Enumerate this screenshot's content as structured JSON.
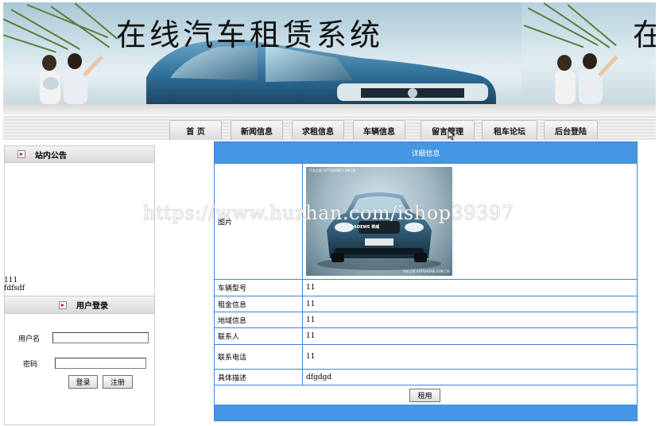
{
  "header": {
    "title": "在线汽车租赁系统",
    "title_repeat": "在"
  },
  "nav": {
    "items": [
      {
        "label": "首  页"
      },
      {
        "label": "新闻信息"
      },
      {
        "label": "求租信息"
      },
      {
        "label": "车辆信息"
      },
      {
        "label": "留言管理"
      },
      {
        "label": "租车论坛"
      },
      {
        "label": "后台登陆"
      }
    ]
  },
  "sidebar": {
    "notice_title": "站内公告",
    "notice_lines": [
      "111",
      "fdfsdf"
    ],
    "login_title": "用户登录",
    "username_label": "用户名",
    "username_value": "",
    "password_label": "密码",
    "password_value": "",
    "login_button": "登录",
    "register_button": "注册"
  },
  "detail": {
    "title": "详细信息",
    "photo_label": "图片",
    "photo_caption_top": "汽车之家  AUTOHOME.COM.CN",
    "photo_caption_bottom": "汽车之家  AUTOHOME.COM.CN",
    "plate_text": "ROEWE 荣威",
    "rows": [
      {
        "key": "车辆型号",
        "value": "11"
      },
      {
        "key": "租金信息",
        "value": "11"
      },
      {
        "key": "地域信息",
        "value": "11"
      },
      {
        "key": "联系人",
        "value": "11"
      },
      {
        "key": "联系电话",
        "value": "11"
      },
      {
        "key": "具体描述",
        "value": "dfgdgd"
      }
    ],
    "rent_button": "租用"
  },
  "overlay": {
    "watermark": "https://www.huzhan.com/ishop39397"
  },
  "colors": {
    "detail_blue": "#4596e3",
    "border_blue": "#3f83d3"
  }
}
